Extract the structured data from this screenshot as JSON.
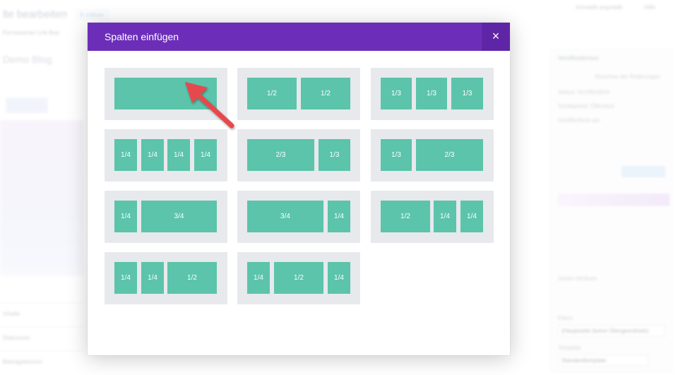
{
  "background": {
    "title": "lte bearbeiten",
    "badge": "B  edliser",
    "top_right": {
      "user": "Anmeldlt  angrstellt",
      "help": "Hilfe"
    },
    "subtitle_row": "Permanenter Link Bea",
    "blog_title": "Demo Blog",
    "left_rows": [
      "Inhalte",
      "Diskussion",
      "Beitragsbereich"
    ],
    "right_panel": {
      "header": "Veröffentlichen",
      "preview": "Vorschau der Änderungen",
      "status_lines": [
        "Status: Veröffentlicht",
        "Sichtbarkeit: Öffentlich",
        "Veröffentlicht am"
      ],
      "update_button": "Aktualisieren",
      "attributes": "Seiten-Attribute",
      "parent_label": "Eltern",
      "parent_value": "(Hauptseite (keine Übergeordnete)",
      "template_label": "Template",
      "template_value": "Standardtemplate"
    }
  },
  "modal": {
    "title": "Spalten einfügen",
    "close_label": "×",
    "layouts": [
      {
        "name": "1-col",
        "columns": [
          ""
        ]
      },
      {
        "name": "1-2_1-2",
        "columns": [
          "1/2",
          "1/2"
        ]
      },
      {
        "name": "1-3_1-3_1-3",
        "columns": [
          "1/3",
          "1/3",
          "1/3"
        ]
      },
      {
        "name": "1-4x4",
        "columns": [
          "1/4",
          "1/4",
          "1/4",
          "1/4"
        ]
      },
      {
        "name": "2-3_1-3",
        "columns": [
          "2/3",
          "1/3"
        ]
      },
      {
        "name": "1-3_2-3",
        "columns": [
          "1/3",
          "2/3"
        ]
      },
      {
        "name": "1-4_3-4",
        "columns": [
          "1/4",
          "3/4"
        ]
      },
      {
        "name": "3-4_1-4",
        "columns": [
          "3/4",
          "1/4"
        ]
      },
      {
        "name": "1-2_1-4_1-4",
        "columns": [
          "1/2",
          "1/4",
          "1/4"
        ]
      },
      {
        "name": "1-4_1-4_1-2",
        "columns": [
          "1/4",
          "1/4",
          "1/2"
        ]
      },
      {
        "name": "1-4_1-2_1-4",
        "columns": [
          "1/4",
          "1/2",
          "1/4"
        ]
      }
    ]
  },
  "colors": {
    "header": "#6c2eb9",
    "column": "#5bc4ab",
    "tile": "#e7e9ec",
    "arrow": "#e5484d"
  },
  "icons": {
    "close": "close-icon",
    "annotation": "red-arrow-icon"
  }
}
